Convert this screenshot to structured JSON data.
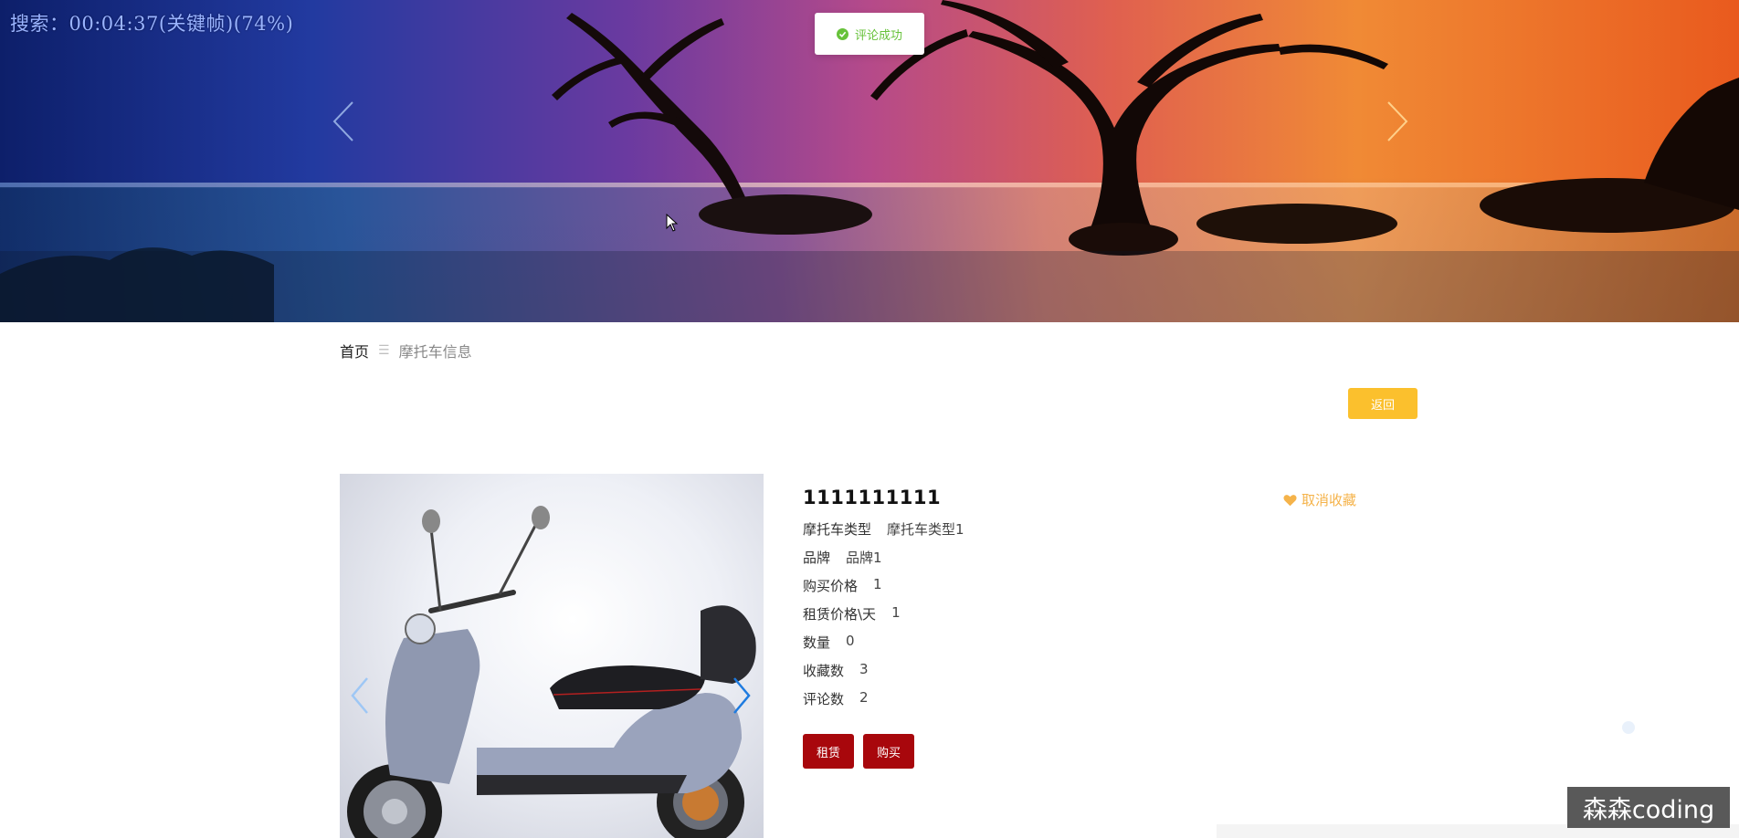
{
  "overlay": {
    "text": "搜索：00:04:37(关键帧)(74%)"
  },
  "toast": {
    "message": "评论成功"
  },
  "breadcrumb": {
    "home": "首页",
    "separator": "☰",
    "current": "摩托车信息"
  },
  "toolbar": {
    "back_label": "返回"
  },
  "product": {
    "title": "1111111111",
    "fields": [
      {
        "label": "摩托车类型",
        "value": "摩托车类型1"
      },
      {
        "label": "品牌",
        "value": "品牌1"
      },
      {
        "label": "购买价格",
        "value": "1"
      },
      {
        "label": "租赁价格\\天",
        "value": "1"
      },
      {
        "label": "数量",
        "value": "0"
      },
      {
        "label": "收藏数",
        "value": "3"
      },
      {
        "label": "评论数",
        "value": "2"
      }
    ],
    "favorite_label": "取消收藏",
    "rent_label": "租赁",
    "buy_label": "购买"
  },
  "watermark": {
    "text": "森森coding"
  },
  "colors": {
    "accent_yellow": "#fbc02d",
    "action_red": "#a8070c",
    "success_green": "#67c23a",
    "favorite_orange": "#f5b34a"
  },
  "icons": [
    "check-circle-icon",
    "chevron-left-icon",
    "chevron-right-icon",
    "heart-icon",
    "mouse-cursor-icon"
  ]
}
